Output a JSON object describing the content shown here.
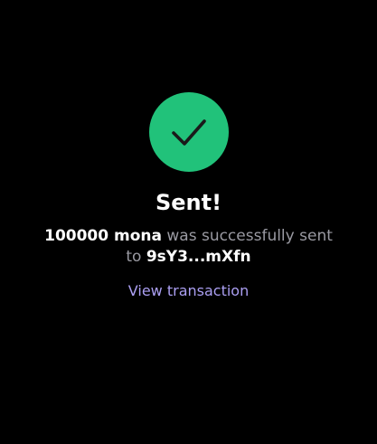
{
  "success": {
    "icon": "checkmark-icon",
    "title": "Sent!",
    "amount": "100000 mona",
    "text_middle": "was successfully sent to",
    "recipient": "9sY3...mXfn",
    "link_label": "View transaction"
  },
  "colors": {
    "background": "#000000",
    "success_green": "#21c27a",
    "link_purple": "#ab9ff2",
    "muted_text": "#9a9aa2",
    "primary_text": "#ffffff"
  }
}
